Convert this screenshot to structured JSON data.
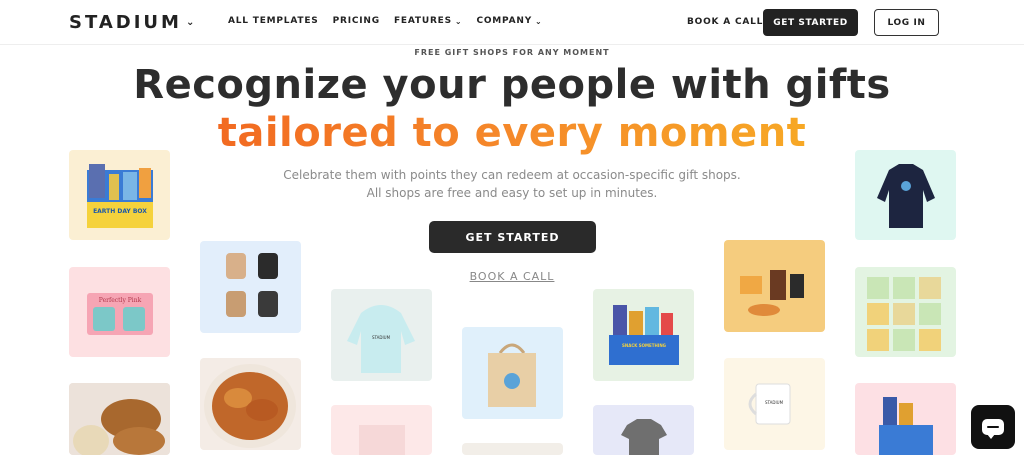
{
  "nav": {
    "logo": "STADIUM",
    "links": [
      "ALL TEMPLATES",
      "PRICING",
      "FEATURES",
      "COMPANY"
    ],
    "book_call": "BOOK A CALL",
    "get_started": "GET STARTED",
    "login": "LOG IN"
  },
  "hero": {
    "eyebrow": "FREE GIFT SHOPS FOR ANY MOMENT",
    "headline_line1": "Recognize your people with gifts",
    "headline_line2": "tailored to every moment",
    "subtext_line1": "Celebrate them with points they can redeem at occasion-specific gift shops.",
    "subtext_line2": "All shops are free and easy to set up in minutes.",
    "cta_primary": "GET STARTED",
    "cta_secondary": "BOOK A CALL"
  },
  "gallery": {
    "earth_day_box": "EARTH DAY BOX",
    "perfectly_pink": "Perfectly Pink",
    "snack_box_label": "SNACK SOMETHING",
    "merch_label": "STADIUM"
  },
  "colors": {
    "accent_orange": "#f26a21",
    "accent_yellow": "#f7a825",
    "dark": "#222222"
  },
  "icons": {
    "chat": "chat-bubble-icon",
    "dropdown": "chevron-down-icon"
  }
}
